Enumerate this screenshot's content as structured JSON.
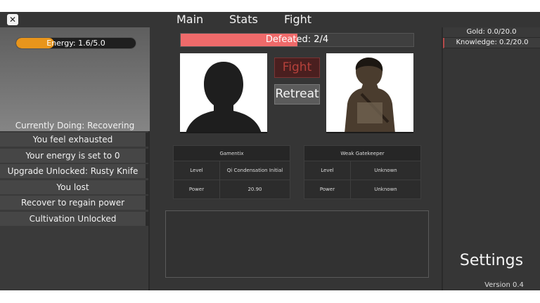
{
  "nav": {
    "close_icon": "close-icon",
    "tabs": [
      {
        "label": "Main"
      },
      {
        "label": "Stats"
      },
      {
        "label": "Fight"
      }
    ]
  },
  "left": {
    "energy": {
      "label": "Energy: 1.6/5.0",
      "current": 1.6,
      "max": 5.0,
      "color": "#e8951c"
    },
    "current_doing": "Currently Doing: Recovering",
    "log": [
      "You feel exhausted",
      "Your energy is set to 0",
      "Upgrade Unlocked: Rusty Knife",
      "You lost",
      "Recover to regain power",
      "Cultivation Unlocked"
    ]
  },
  "battle": {
    "defeated": {
      "label": "Defeated: 2/4",
      "current": 2,
      "max": 4,
      "color": "#ef6a6a"
    },
    "fight_label": "Fight",
    "retreat_label": "Retreat",
    "player": {
      "name": "Gamentix",
      "level_label": "Level",
      "level": "Qi Condensation Initial",
      "power_label": "Power",
      "power": "20.90"
    },
    "enemy": {
      "name": "Weak Gatekeeper",
      "level_label": "Level",
      "level": "Unknown",
      "power_label": "Power",
      "power": "Unknown"
    }
  },
  "right": {
    "gold": "Gold: 0.0/20.0",
    "knowledge": "Knowledge: 0.2/20.0",
    "settings_label": "Settings",
    "version": "Version 0.4"
  }
}
